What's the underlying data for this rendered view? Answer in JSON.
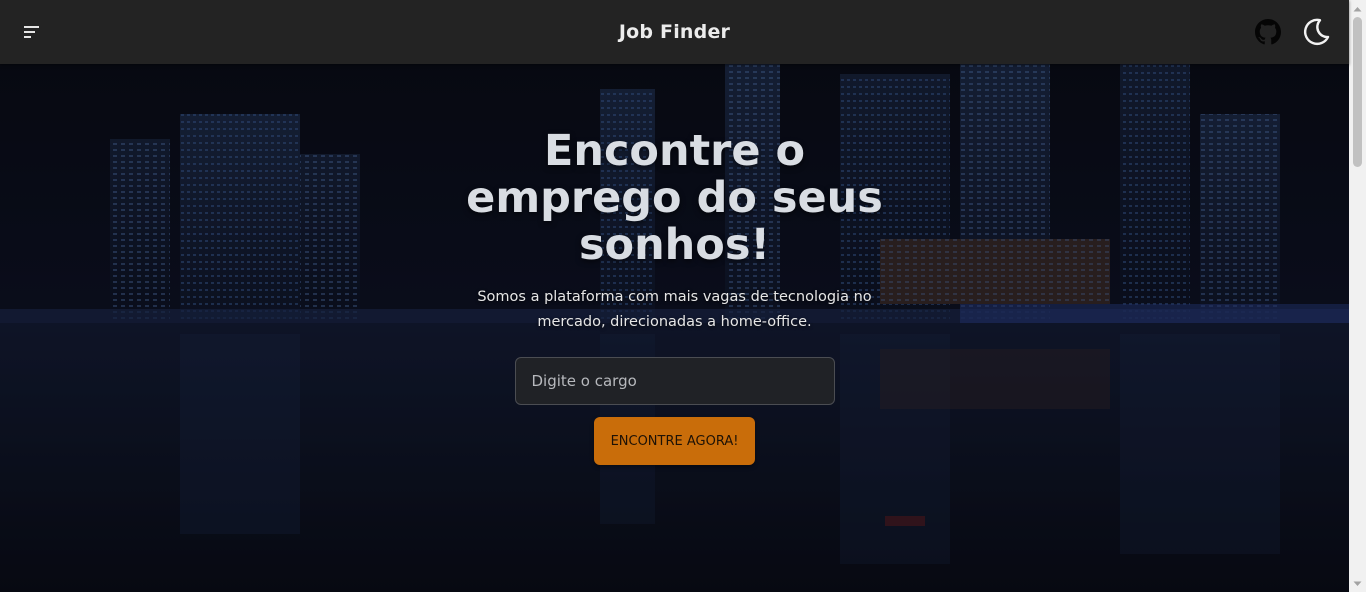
{
  "header": {
    "title": "Job Finder",
    "menu_icon": "menu-icon",
    "github_icon": "github-icon",
    "theme_icon": "moon-icon"
  },
  "hero": {
    "headline": "Encontre o emprego do seus sonhos!",
    "subtitle": "Somos a plataforma com mais vagas de tecnologia no mercado, direcionadas a home-office.",
    "search": {
      "placeholder": "Digite o cargo",
      "value": ""
    },
    "cta_label": "ENCONTRE AGORA!"
  },
  "colors": {
    "topbar": "#232323",
    "accent": "#c96d0a",
    "text": "#d9dde3"
  }
}
